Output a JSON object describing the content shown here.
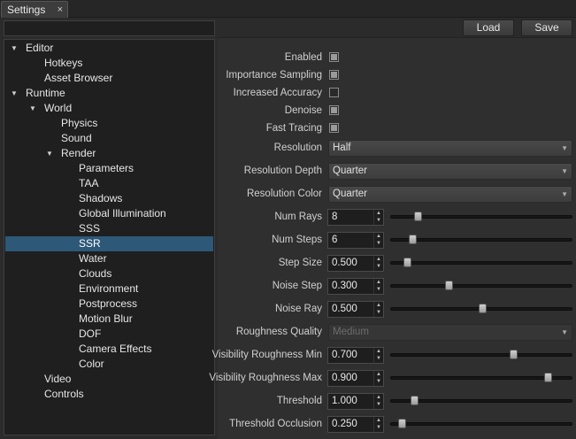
{
  "tab": {
    "title": "Settings",
    "close_glyph": "×",
    "close_icon": "close-icon"
  },
  "search": {
    "placeholder": ""
  },
  "tree": [
    {
      "label": "Editor",
      "level": 0,
      "expanded": true
    },
    {
      "label": "Hotkeys",
      "level": 1
    },
    {
      "label": "Asset Browser",
      "level": 1
    },
    {
      "label": "Runtime",
      "level": 0,
      "expanded": true
    },
    {
      "label": "World",
      "level": 1,
      "expanded": true
    },
    {
      "label": "Physics",
      "level": 2
    },
    {
      "label": "Sound",
      "level": 2
    },
    {
      "label": "Render",
      "level": 2,
      "expanded": true
    },
    {
      "label": "Parameters",
      "level": 3
    },
    {
      "label": "TAA",
      "level": 3
    },
    {
      "label": "Shadows",
      "level": 3
    },
    {
      "label": "Global Illumination",
      "level": 3
    },
    {
      "label": "SSS",
      "level": 3
    },
    {
      "label": "SSR",
      "level": 3,
      "selected": true
    },
    {
      "label": "Water",
      "level": 3
    },
    {
      "label": "Clouds",
      "level": 3
    },
    {
      "label": "Environment",
      "level": 3
    },
    {
      "label": "Postprocess",
      "level": 3
    },
    {
      "label": "Motion Blur",
      "level": 3
    },
    {
      "label": "DOF",
      "level": 3
    },
    {
      "label": "Camera Effects",
      "level": 3
    },
    {
      "label": "Color",
      "level": 3
    },
    {
      "label": "Video",
      "level": 1
    },
    {
      "label": "Controls",
      "level": 1
    }
  ],
  "toolbar": {
    "load_label": "Load",
    "save_label": "Save"
  },
  "checkboxes": [
    {
      "label": "Enabled",
      "checked": true
    },
    {
      "label": "Importance Sampling",
      "checked": true
    },
    {
      "label": "Increased Accuracy",
      "checked": false
    },
    {
      "label": "Denoise",
      "checked": true
    },
    {
      "label": "Fast Tracing",
      "checked": true
    }
  ],
  "combos": [
    {
      "label": "Resolution",
      "value": "Half",
      "disabled": false
    },
    {
      "label": "Resolution Depth",
      "value": "Quarter",
      "disabled": false
    },
    {
      "label": "Resolution Color",
      "value": "Quarter",
      "disabled": false
    }
  ],
  "sliders_a": [
    {
      "label": "Num Rays",
      "value": "8",
      "fraction": 0.13
    },
    {
      "label": "Num Steps",
      "value": "6",
      "fraction": 0.1
    },
    {
      "label": "Step Size",
      "value": "0.500",
      "fraction": 0.07
    },
    {
      "label": "Noise Step",
      "value": "0.300",
      "fraction": 0.31
    },
    {
      "label": "Noise Ray",
      "value": "0.500",
      "fraction": 0.5
    }
  ],
  "roughness_quality": {
    "label": "Roughness Quality",
    "value": "Medium",
    "disabled": true
  },
  "sliders_b": [
    {
      "label": "Visibility Roughness Min",
      "value": "0.700",
      "fraction": 0.68
    },
    {
      "label": "Visibility Roughness Max",
      "value": "0.900",
      "fraction": 0.88
    },
    {
      "label": "Threshold",
      "value": "1.000",
      "fraction": 0.11
    },
    {
      "label": "Threshold Occlusion",
      "value": "0.250",
      "fraction": 0.04
    }
  ]
}
